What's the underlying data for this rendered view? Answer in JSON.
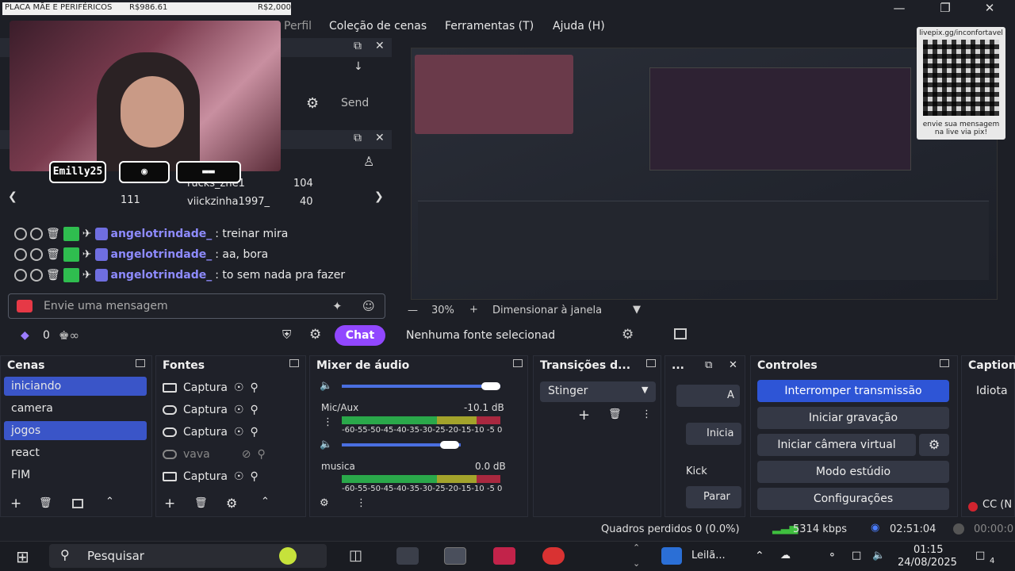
{
  "goal": {
    "label": "PLACA MÃE E PERIFÉRICOS",
    "current": "R$986.61",
    "target": "R$2,000"
  },
  "menu": [
    "Perfil",
    "Coleção de cenas",
    "Ferramentas (T)",
    "Ajuda (H)"
  ],
  "webcam": {
    "name": "Emilly25"
  },
  "chat": {
    "send_label": "Send",
    "viewers": [
      {
        "name": "rucks_zne1",
        "count": "104"
      },
      {
        "name": "viickzinha1997_",
        "count": "40"
      },
      {
        "count": "111"
      }
    ],
    "messages": [
      {
        "user": "angelotrindade_",
        "text": ": treinar mira"
      },
      {
        "user": "angelotrindade_",
        "text": ": aa, bora"
      },
      {
        "user": "angelotrindade_",
        "text": ": to sem nada pra fazer"
      }
    ],
    "input_placeholder": "Envie uma mensagem",
    "points": "0",
    "chat_button": "Chat"
  },
  "qr": {
    "top_text": "livepix.gg/inconfortavel",
    "bottom_text": "envie sua mensagem na live via pix!"
  },
  "zoom": {
    "value": "30%",
    "fit_label": "Dimensionar à janela"
  },
  "source_status": "Nenhuma fonte selecionad",
  "docks": {
    "scenes": {
      "title": "Cenas",
      "items": [
        "iniciando",
        "camera",
        "jogos",
        "react",
        "FIM"
      ],
      "selected": [
        0,
        2
      ]
    },
    "sources": {
      "title": "Fontes",
      "items": [
        "Captura",
        "Captura",
        "Captura",
        "vava",
        "Captura"
      ]
    },
    "mixer": {
      "title": "Mixer de áudio",
      "channels": [
        {
          "name": "Mic/Aux",
          "db": "-10.1 dB"
        },
        {
          "name": "musica",
          "db": "0.0 dB"
        }
      ],
      "scale": "-60-55-50-45-40-35-30-25-20-15-10 -5  0"
    },
    "transitions": {
      "title": "Transições d...",
      "selected": "Stinger"
    },
    "misc": {
      "title": "...",
      "labels": [
        "A",
        "Inicia",
        "Kick",
        "Parar"
      ]
    },
    "controls": {
      "title": "Controles",
      "buttons": [
        "Interromper transmissão",
        "Iniciar gravação",
        "Iniciar câmera virtual",
        "Modo estúdio",
        "Configurações"
      ]
    },
    "captions": {
      "title": "Caption",
      "text": "Idiota",
      "cc": "CC (N"
    }
  },
  "status": {
    "dropped": "Quadros perdidos 0 (0.0%)",
    "bitrate": "5314 kbps",
    "live_time": "02:51:04",
    "rec_time": "00:00:0"
  },
  "taskbar": {
    "search": "Pesquisar",
    "app_label": "Leilã...",
    "time": "01:15",
    "date": "24/08/2025",
    "notif_count": "4"
  },
  "colors": {
    "accent": "#3a55c8",
    "chat_btn": "#9147ff",
    "bg": "#1d1f26"
  }
}
